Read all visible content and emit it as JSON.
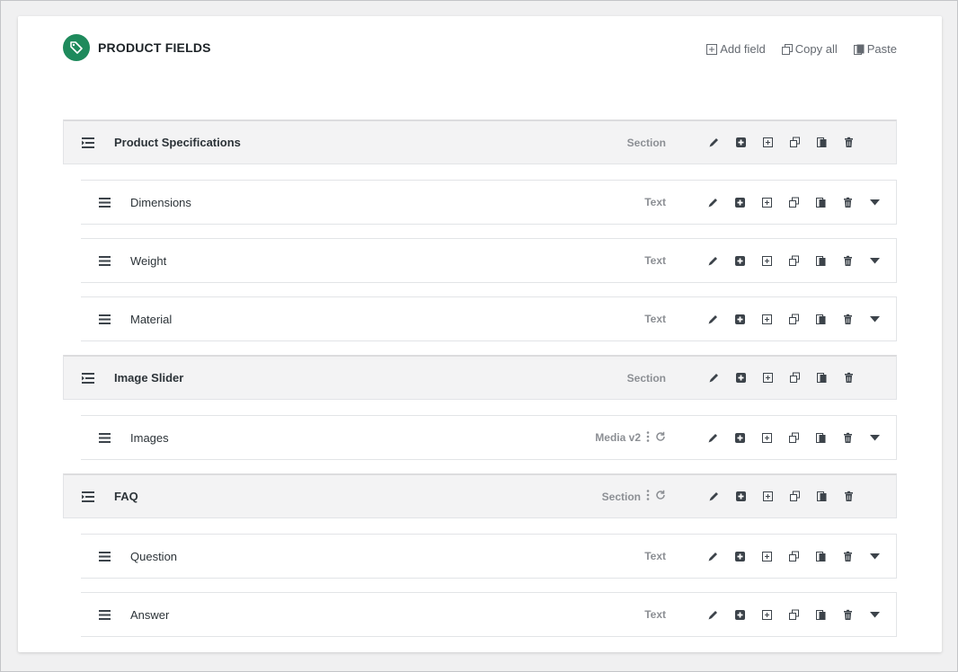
{
  "header": {
    "title": "PRODUCT FIELDS",
    "icon": "tag-icon",
    "accent": "#1e8a5c",
    "actions": {
      "add_field": "Add field",
      "copy_all": "Copy all",
      "paste": "Paste"
    }
  },
  "rows": [
    {
      "kind": "section",
      "label": "Product Specifications",
      "type": "Section"
    },
    {
      "kind": "field",
      "label": "Dimensions",
      "type": "Text"
    },
    {
      "kind": "field",
      "label": "Weight",
      "type": "Text"
    },
    {
      "kind": "field",
      "label": "Material",
      "type": "Text"
    },
    {
      "kind": "section",
      "label": "Image Slider",
      "type": "Section"
    },
    {
      "kind": "field",
      "label": "Images",
      "type": "Media v2",
      "extra": true
    },
    {
      "kind": "section",
      "label": "FAQ",
      "type": "Section",
      "extra": true
    },
    {
      "kind": "field",
      "label": "Question",
      "type": "Text"
    },
    {
      "kind": "field",
      "label": "Answer",
      "type": "Text"
    }
  ]
}
